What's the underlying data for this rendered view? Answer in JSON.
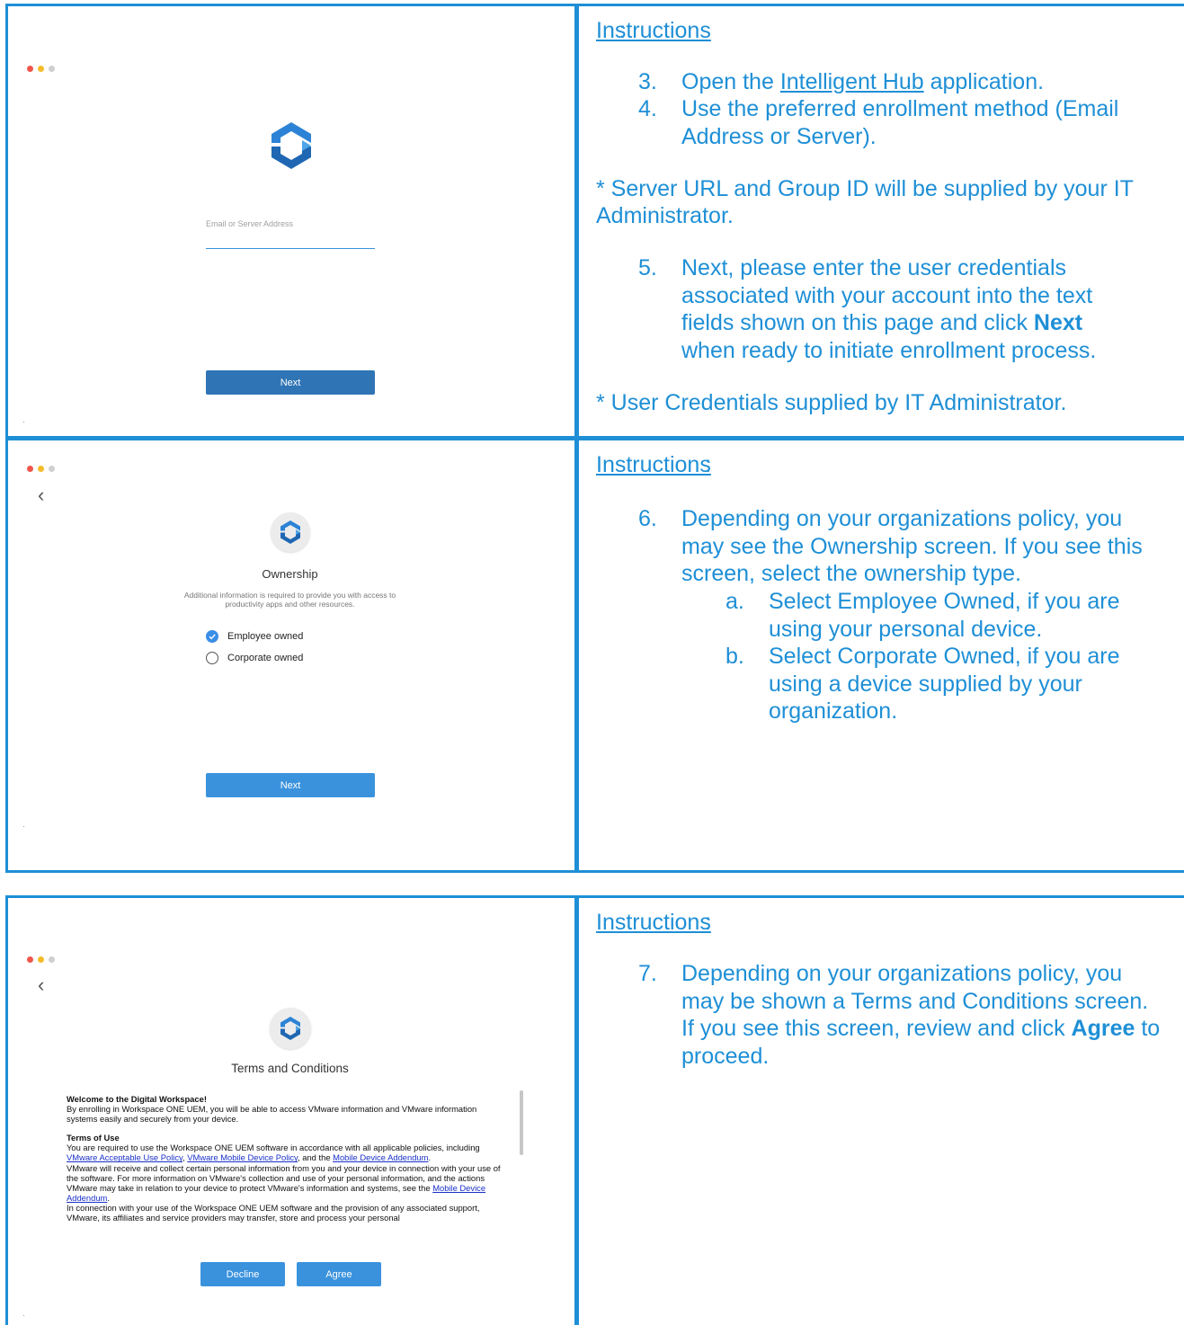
{
  "colors": {
    "accent": "#1e8fd6",
    "button_dark": "#2f74b5",
    "button_light": "#3a92dd",
    "link": "#1a31c8"
  },
  "icons": {
    "traffic_lights": [
      "red",
      "yellow",
      "gray"
    ],
    "hub_logo": "workspace-one-hub-logo",
    "back": "chevron-left-icon",
    "check": "checkmark-icon"
  },
  "row1": {
    "screen": {
      "email_placeholder": "Email or Server Address",
      "next_label": "Next"
    },
    "instructions_heading": "Instructions",
    "steps": [
      {
        "num": "3.",
        "text_pre": "Open the ",
        "link": "Intelligent Hub",
        "text_post": " application."
      },
      {
        "num": "4.",
        "text": "Use the preferred enrollment method (Email Address or Server)."
      }
    ],
    "note1": "* Server URL and Group ID will be supplied by your IT Administrator.",
    "step5": {
      "num": "5.",
      "text_pre": "Next, please enter the user credentials associated with your account into the text fields shown on this page and click ",
      "bold": "Next",
      "text_post": " when ready to initiate enrollment process."
    },
    "note2": "* User Credentials supplied by IT Administrator."
  },
  "row2": {
    "screen": {
      "title": "Ownership",
      "subtitle_line1": "Additional information is required to provide you with access to",
      "subtitle_line2": "productivity apps and other resources.",
      "option_employee": "Employee owned",
      "option_corporate": "Corporate owned",
      "next_label": "Next"
    },
    "instructions_heading": "Instructions",
    "step6": {
      "num": "6.",
      "text": "Depending on your organizations policy, you may see the Ownership screen. If you see this screen, select the ownership type."
    },
    "sub_a": {
      "num": "a.",
      "text": "Select Employee Owned, if you are using your personal device."
    },
    "sub_b": {
      "num": "b.",
      "text": "Select Corporate Owned, if you are using a device supplied by your organization."
    }
  },
  "row3": {
    "screen": {
      "title": "Terms and Conditions",
      "welcome_heading": "Welcome to the Digital Workspace!",
      "welcome_body": "By enrolling in Workspace ONE UEM, you will be able to access VMware information and VMware information systems easily and securely from your device.",
      "terms_heading": "Terms of Use",
      "p1_pre": "You are required to use the Workspace ONE UEM software in accordance with all applicable policies, including ",
      "link_aup": "VMware Acceptable Use Policy",
      "p1_mid1": ", ",
      "link_mdp": "VMware Mobile Device Policy",
      "p1_mid2": ", and the ",
      "link_mda": "Mobile Device Addendum",
      "p1_post": ".",
      "p2_pre": "VMware will receive and collect certain personal information from you and your device in connection with your use of the software. For more information on VMware's collection and use of your personal information, and the actions VMware may take in relation to your device to protect VMware's information and systems, see the ",
      "link_mda2": "Mobile Device Addendum",
      "p2_post": ".",
      "p3": "In connection with your use of the Workspace ONE UEM software and the provision of any associated support, VMware, its affiliates and service providers may transfer, store and process your personal",
      "decline_label": "Decline",
      "agree_label": "Agree"
    },
    "instructions_heading": "Instructions",
    "step7": {
      "num": "7.",
      "text_pre": "Depending on your organizations policy, you may be shown a Terms and Conditions screen. If you see this screen, review and click ",
      "bold": "Agree",
      "text_post": " to proceed."
    }
  }
}
